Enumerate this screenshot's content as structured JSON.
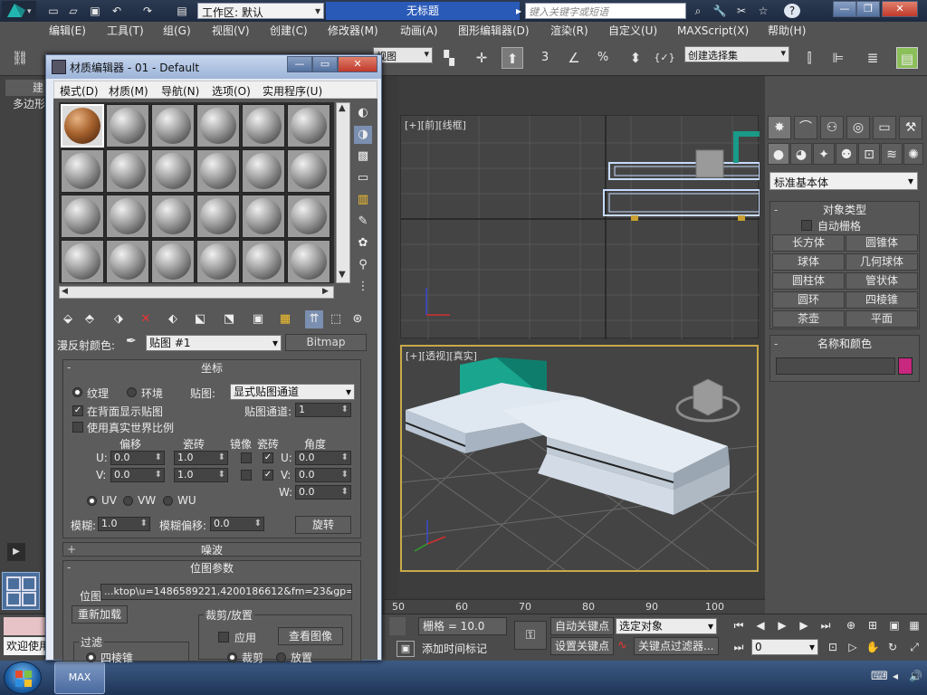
{
  "titlebar": {
    "workspace": "工作区: 默认",
    "doc_title": "无标题",
    "search_placeholder": "键入关键字或短语"
  },
  "menu": [
    "编辑(E)",
    "工具(T)",
    "组(G)",
    "视图(V)",
    "创建(C)",
    "修改器(M)",
    "动画(A)",
    "图形编辑器(D)",
    "渲染(R)",
    "自定义(U)",
    "MAXScript(X)",
    "帮助(H)"
  ],
  "toolbar": {
    "view_dropdown": "视图",
    "selection_set": "创建选择集",
    "num_labels": [
      "3",
      "%"
    ]
  },
  "left_tools": [
    "建",
    "多边形"
  ],
  "viewports": {
    "top_label": "[+][前][线框]",
    "persp_label": "[+][透视][真实]"
  },
  "command_panel": {
    "category": "标准基本体",
    "object_type_title": "对象类型",
    "autogrid": "自动栅格",
    "objects": [
      "长方体",
      "圆锥体",
      "球体",
      "几何球体",
      "圆柱体",
      "管状体",
      "圆环",
      "四棱锥",
      "茶壶",
      "平面"
    ],
    "name_color_title": "名称和颜色",
    "swatch_color": "#c8287e"
  },
  "ruler": [
    "50",
    "60",
    "70",
    "80",
    "90",
    "100"
  ],
  "bottom": {
    "grid": "栅格 = 10.0",
    "add_time_tag": "添加时间标记",
    "auto_key": "自动关键点",
    "set_key": "设置关键点",
    "selected": "选定对象",
    "key_filters": "关键点过滤器...",
    "frame": "0",
    "welcome": "欢迎使用"
  },
  "taskbar": {
    "app": "MAX"
  },
  "mat_editor": {
    "title": "材质编辑器 - 01 - Default",
    "menu": [
      "模式(D)",
      "材质(M)",
      "导航(N)",
      "选项(O)",
      "实用程序(U)"
    ],
    "diffuse_label": "漫反射颜色:",
    "map_name": "贴图 #1",
    "map_type": "Bitmap",
    "coords": {
      "title": "坐标",
      "texture": "纹理",
      "environ": "环境",
      "mapping_label": "贴图:",
      "mapping_value": "显式贴图通道",
      "show_back": "在背面显示贴图",
      "map_channel_label": "贴图通道:",
      "map_channel": "1",
      "real_world": "使用真实世界比例",
      "offset": "偏移",
      "tiling": "瓷砖",
      "mirror": "镜像",
      "tile": "瓷砖",
      "angle": "角度",
      "u": "U:",
      "v": "V:",
      "w": "W:",
      "u_offset": "0.0",
      "v_offset": "0.0",
      "u_tiling": "1.0",
      "v_tiling": "1.0",
      "u_angle": "0.0",
      "v_angle": "0.0",
      "w_angle": "0.0",
      "uv": "UV",
      "vw": "VW",
      "wu": "WU",
      "blur_label": "模糊:",
      "blur": "1.0",
      "blur_offset_label": "模糊偏移:",
      "blur_offset": "0.0",
      "rotate": "旋转"
    },
    "noise_title": "噪波",
    "bitmap_params_title": "位图参数",
    "bitmap_label": "位图:",
    "bitmap_path": "...ktop\\u=1486589221,4200186612&fm=23&gp=0.jpg",
    "reload": "重新加载",
    "crop_title": "裁剪/放置",
    "apply": "应用",
    "view_image": "查看图像",
    "filter_title": "过滤",
    "filter_opt": "四棱锥",
    "crop": "裁剪",
    "place": "放置"
  }
}
